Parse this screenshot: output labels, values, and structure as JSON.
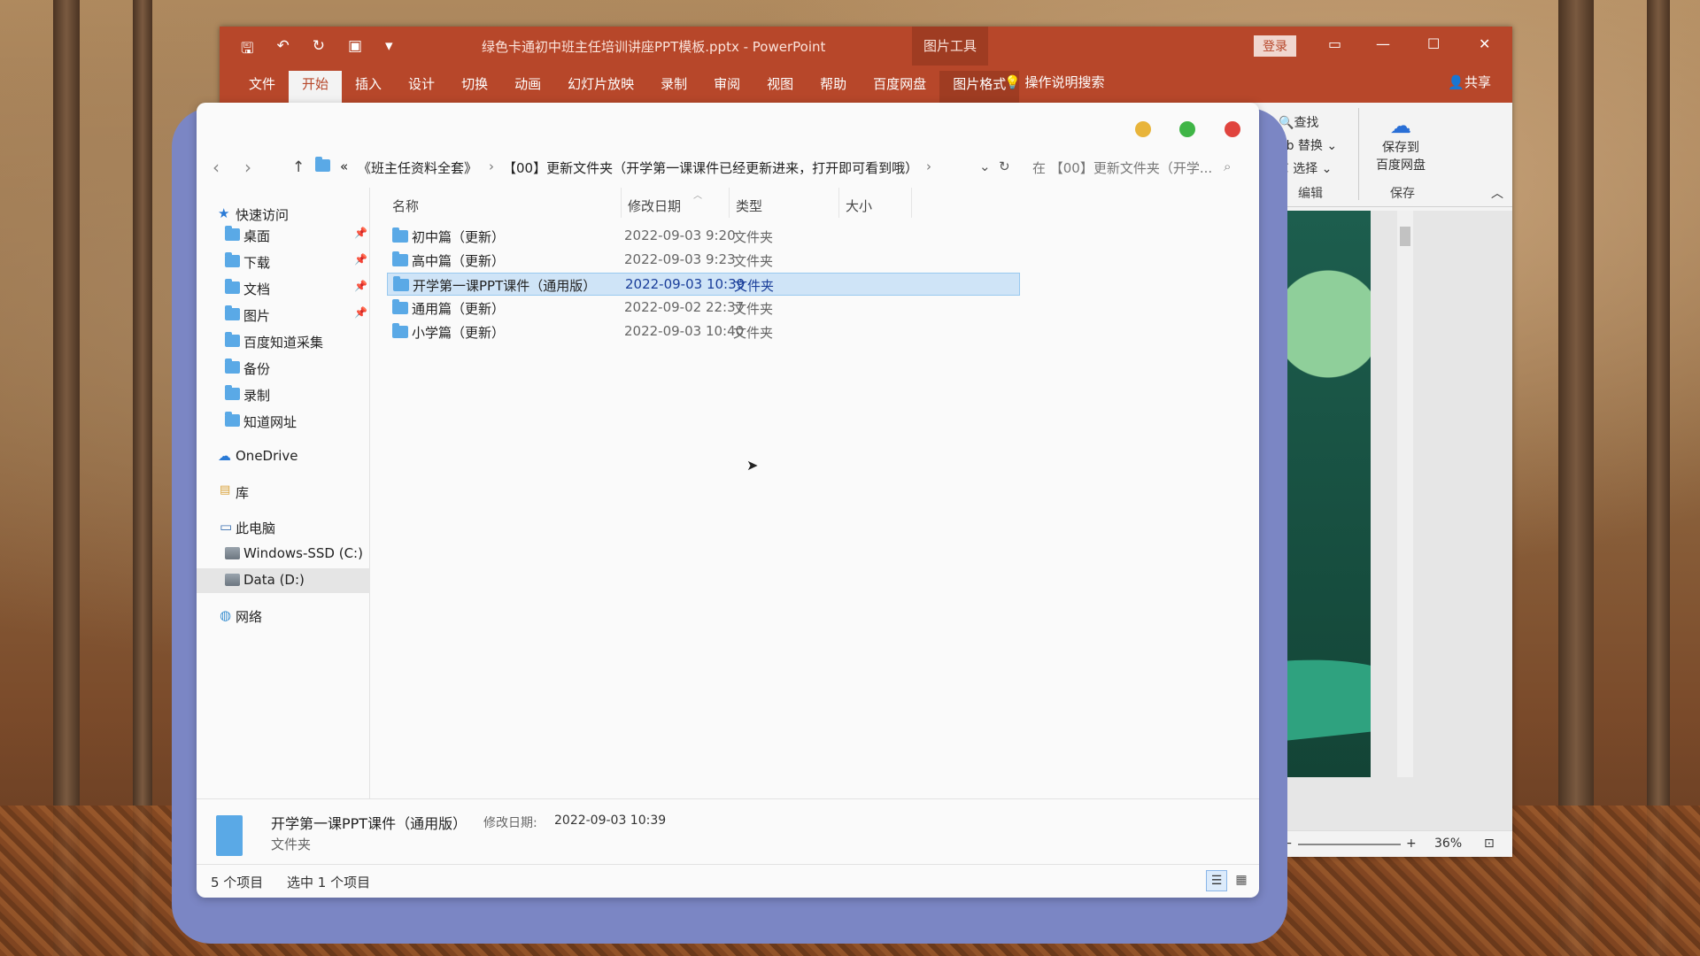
{
  "ppt": {
    "title": "绿色卡通初中班主任培训讲座PPT模板.pptx  -  PowerPoint",
    "context_tab": "图片工具",
    "login_label": "登录",
    "tabs": [
      "文件",
      "开始",
      "插入",
      "设计",
      "切换",
      "动画",
      "幻灯片放映",
      "录制",
      "审阅",
      "视图",
      "帮助",
      "百度网盘",
      "图片格式"
    ],
    "active_tab": "开始",
    "search_label": "操作说明搜索",
    "share_label": "共享",
    "ribbon": {
      "find_label": "查找",
      "replace_label": "替换",
      "select_label": "选择",
      "edit_group": "编辑",
      "save_to_label_1": "保存到",
      "save_to_label_2": "百度网盘",
      "save_group": "保存"
    },
    "zoom_label": "36%"
  },
  "explorer": {
    "breadcrumb": {
      "prefix": "«",
      "parent": "《班主任资料全套》",
      "current": "【00】更新文件夹（开学第一课课件已经更新进来，打开即可看到哦）"
    },
    "search_placeholder": "在 【00】更新文件夹（开学...",
    "sidebar": {
      "quick_access": "快速访问",
      "items": [
        "桌面",
        "下载",
        "文档",
        "图片",
        "百度知道采集",
        "备份",
        "录制",
        "知道网址"
      ],
      "onedrive": "OneDrive",
      "library": "库",
      "this_pc": "此电脑",
      "drives": [
        "Windows-SSD (C:)",
        "Data (D:)"
      ],
      "network": "网络"
    },
    "columns": [
      "名称",
      "修改日期",
      "类型",
      "大小"
    ],
    "files": [
      {
        "name": "初中篇（更新）",
        "date": "2022-09-03 9:20",
        "type": "文件夹"
      },
      {
        "name": "高中篇（更新）",
        "date": "2022-09-03 9:23",
        "type": "文件夹"
      },
      {
        "name": "开学第一课PPT课件（通用版）",
        "date": "2022-09-03 10:39",
        "type": "文件夹"
      },
      {
        "name": "通用篇（更新）",
        "date": "2022-09-02 22:37",
        "type": "文件夹"
      },
      {
        "name": "小学篇（更新）",
        "date": "2022-09-03 10:40",
        "type": "文件夹"
      }
    ],
    "selected_index": 2,
    "details": {
      "name": "开学第一课PPT课件（通用版）",
      "date_label": "修改日期:",
      "date": "2022-09-03 10:39",
      "type": "文件夹"
    },
    "status": {
      "count": "5 个项目",
      "selected": "选中 1 个项目"
    }
  },
  "colors": {
    "ppt_red": "#b7472a",
    "selection": "#cfe4f7",
    "mac_yellow": "#e8b43a",
    "mac_green": "#3fb546",
    "mac_red": "#e0443e"
  }
}
